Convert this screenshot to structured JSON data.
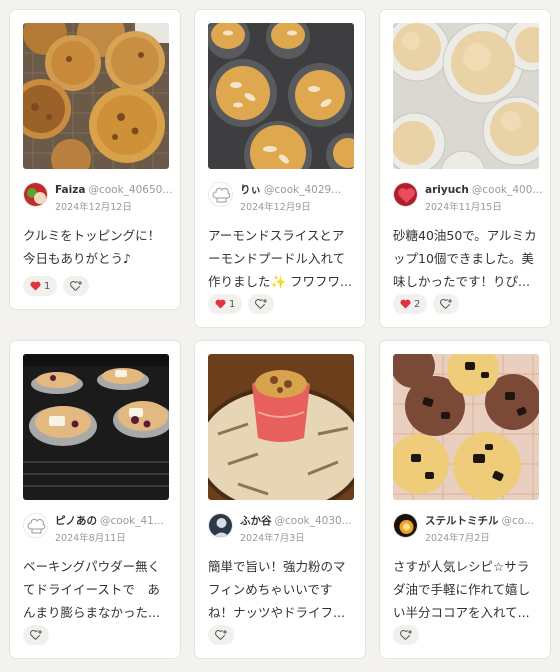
{
  "cards": [
    {
      "name": "Faiza",
      "handle": "@cook_40650...",
      "date": "2024年12月12日",
      "comment": "クルミをトッピングに！今日もありがとう♪",
      "like_count": "1"
    },
    {
      "name": "りぃ",
      "handle": "@cook_4029...",
      "date": "2024年12月9日",
      "comment": "アーモンドスライスとアーモンドプードル入れて作りました✨ フワフワ...",
      "like_count": "1"
    },
    {
      "name": "ariyuch",
      "handle": "@cook_400...",
      "date": "2024年11月15日",
      "comment": "砂糖40油50で。アルミカップ10個できました。美味しかったです！りぴ...",
      "like_count": "2"
    },
    {
      "name": "ピノあの",
      "handle": "@cook_41...",
      "date": "2024年8月11日",
      "comment": "ベーキングパウダー無くてドライイーストで　あんまり膨らまなかった...",
      "like_count": ""
    },
    {
      "name": "ふか谷",
      "handle": "@cook_4030...",
      "date": "2024年7月3日",
      "comment": "簡単で旨い！強力粉のマフィンめちゃいいですね！ナッツやドライフ...",
      "like_count": ""
    },
    {
      "name": "ステルトミチル",
      "handle": "@co...",
      "date": "2024年7月2日",
      "comment": "さすが人気レシピ☆サラダ油で手軽に作れて嬉しい半分ココアを入れて...",
      "like_count": ""
    }
  ],
  "icons": {
    "like": "heart-icon",
    "react": "add-reaction-icon",
    "default_avatar": "chef-hat-icon"
  },
  "colors": {
    "heart": "#e0333f",
    "card_bg": "#ffffff",
    "page_bg": "#f3f2ee"
  }
}
